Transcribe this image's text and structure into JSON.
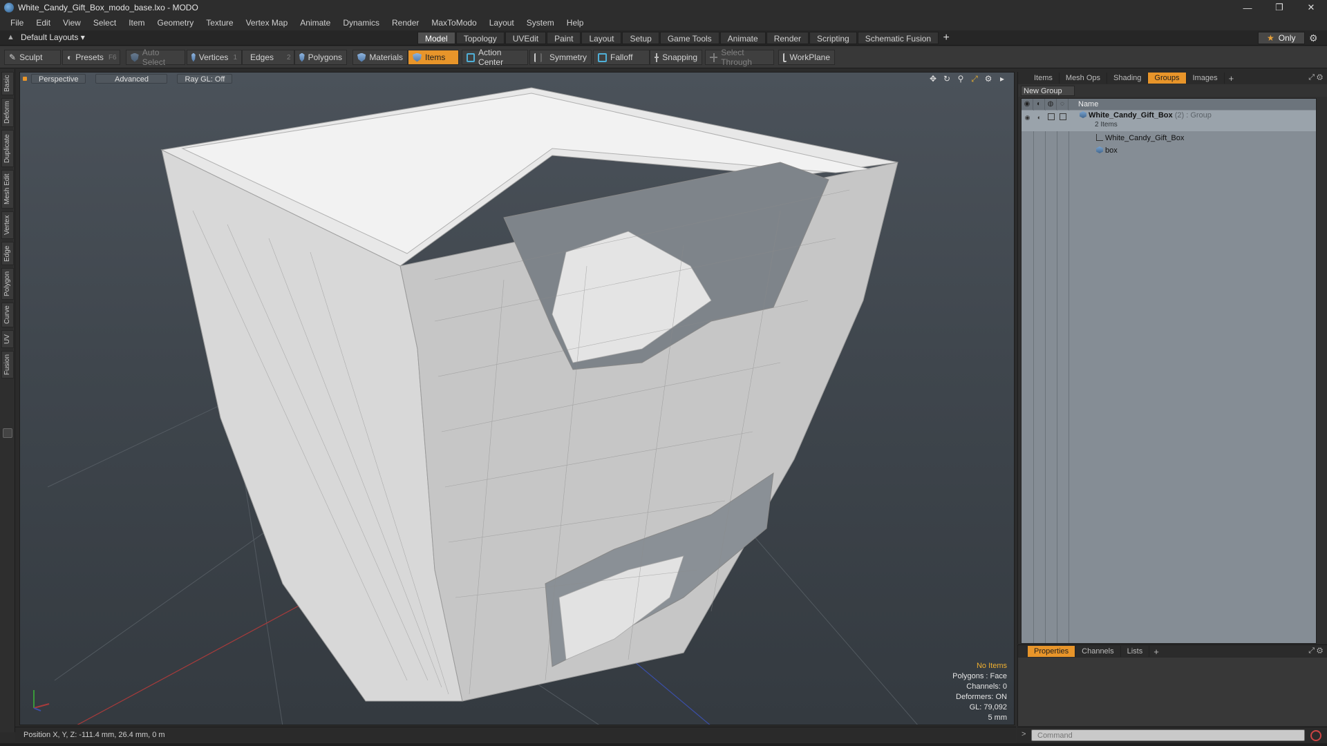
{
  "window": {
    "title": "White_Candy_Gift_Box_modo_base.lxo - MODO",
    "controls": [
      "—",
      "❐",
      "✕"
    ]
  },
  "menu": [
    "File",
    "Edit",
    "View",
    "Select",
    "Item",
    "Geometry",
    "Texture",
    "Vertex Map",
    "Animate",
    "Dynamics",
    "Render",
    "MaxToModo",
    "Layout",
    "System",
    "Help"
  ],
  "layout": {
    "selector": "Default Layouts ▾",
    "tabs": [
      "Model",
      "Topology",
      "UVEdit",
      "Paint",
      "Layout",
      "Setup",
      "Game Tools",
      "Animate",
      "Render",
      "Scripting",
      "Schematic Fusion"
    ],
    "active_tab": "Model",
    "add": "+",
    "only": "Only"
  },
  "toolbar": {
    "sculpt": "Sculpt",
    "presets": "Presets",
    "presets_key": "F6",
    "auto_select": "Auto Select",
    "vertices": "Vertices",
    "vertices_key": "1",
    "edges": "Edges",
    "edges_key": "2",
    "polygons": "Polygons",
    "materials": "Materials",
    "items": "Items",
    "action_center": "Action Center",
    "symmetry": "Symmetry",
    "falloff": "Falloff",
    "snapping": "Snapping",
    "select_through": "Select Through",
    "workplane": "WorkPlane"
  },
  "left_tabs": [
    "Basic",
    "Deform",
    "Duplicate",
    "Mesh Edit",
    "Vertex",
    "Edge",
    "Polygon",
    "Curve",
    "UV",
    "Fusion"
  ],
  "viewport": {
    "view": "Perspective",
    "shading": "Advanced",
    "raygl": "Ray GL: Off",
    "info": {
      "selection": "No Items",
      "polygons": "Polygons : Face",
      "channels": "Channels: 0",
      "deformers": "Deformers: ON",
      "gl": "GL: 79,092",
      "grid": "5 mm"
    }
  },
  "status": {
    "position": "Position X, Y, Z:  -111.4 mm, 26.4 mm, 0 m"
  },
  "right_panel": {
    "tabs": [
      "Items",
      "Mesh Ops",
      "Shading",
      "Groups",
      "Images"
    ],
    "active_tab": "Groups",
    "new_group": "New Group",
    "name_header": "Name",
    "group": {
      "name": "White_Candy_Gift_Box",
      "count": "(2)",
      "type": ": Group",
      "sub": "2 Items",
      "children": [
        "White_Candy_Gift_Box",
        "box"
      ]
    }
  },
  "properties_panel": {
    "tabs": [
      "Properties",
      "Channels",
      "Lists"
    ],
    "active_tab": "Properties"
  },
  "command": {
    "placeholder": "Command"
  },
  "colors": {
    "accent": "#e8952a",
    "viewport_top": "#4b525a",
    "viewport_bottom": "#343a40",
    "warn_text": "#f0b030"
  }
}
